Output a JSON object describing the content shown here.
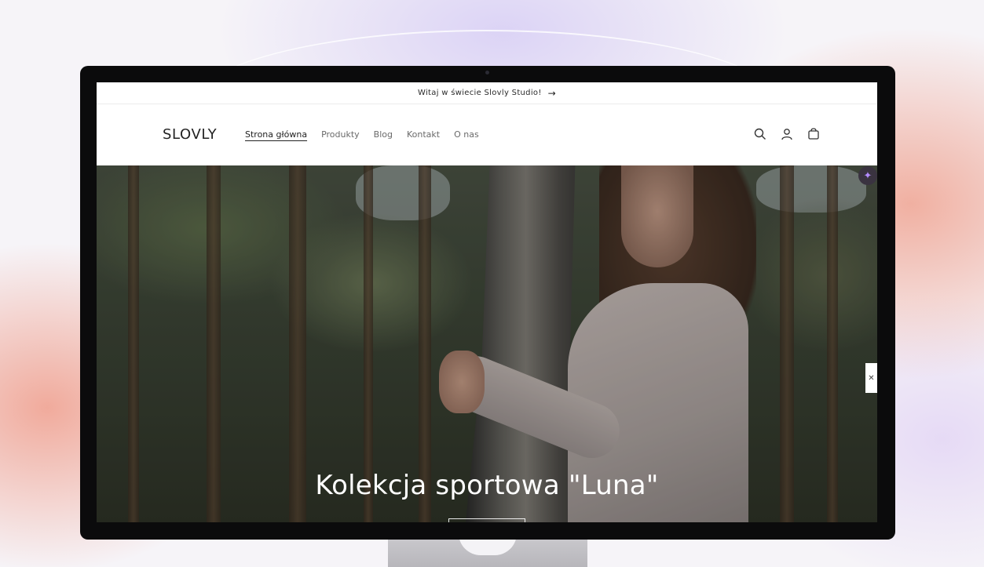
{
  "announcement": {
    "text": "Witaj w świecie Slovly Studio!",
    "arrow_icon": "arrow-right-icon"
  },
  "header": {
    "logo": "SLOVLY",
    "nav": [
      {
        "label": "Strona główna",
        "active": true
      },
      {
        "label": "Produkty",
        "active": false
      },
      {
        "label": "Blog",
        "active": false
      },
      {
        "label": "Kontakt",
        "active": false
      },
      {
        "label": "O nas",
        "active": false
      }
    ],
    "icons": [
      "search-icon",
      "account-icon",
      "cart-icon"
    ]
  },
  "hero": {
    "title": "Kolekcja sportowa \"Luna\"",
    "image": "woman-hugging-birch-tree-in-forest"
  },
  "colors": {
    "accent": "#b48cff",
    "text": "#222222",
    "nav_muted": "#6a6a6a"
  }
}
